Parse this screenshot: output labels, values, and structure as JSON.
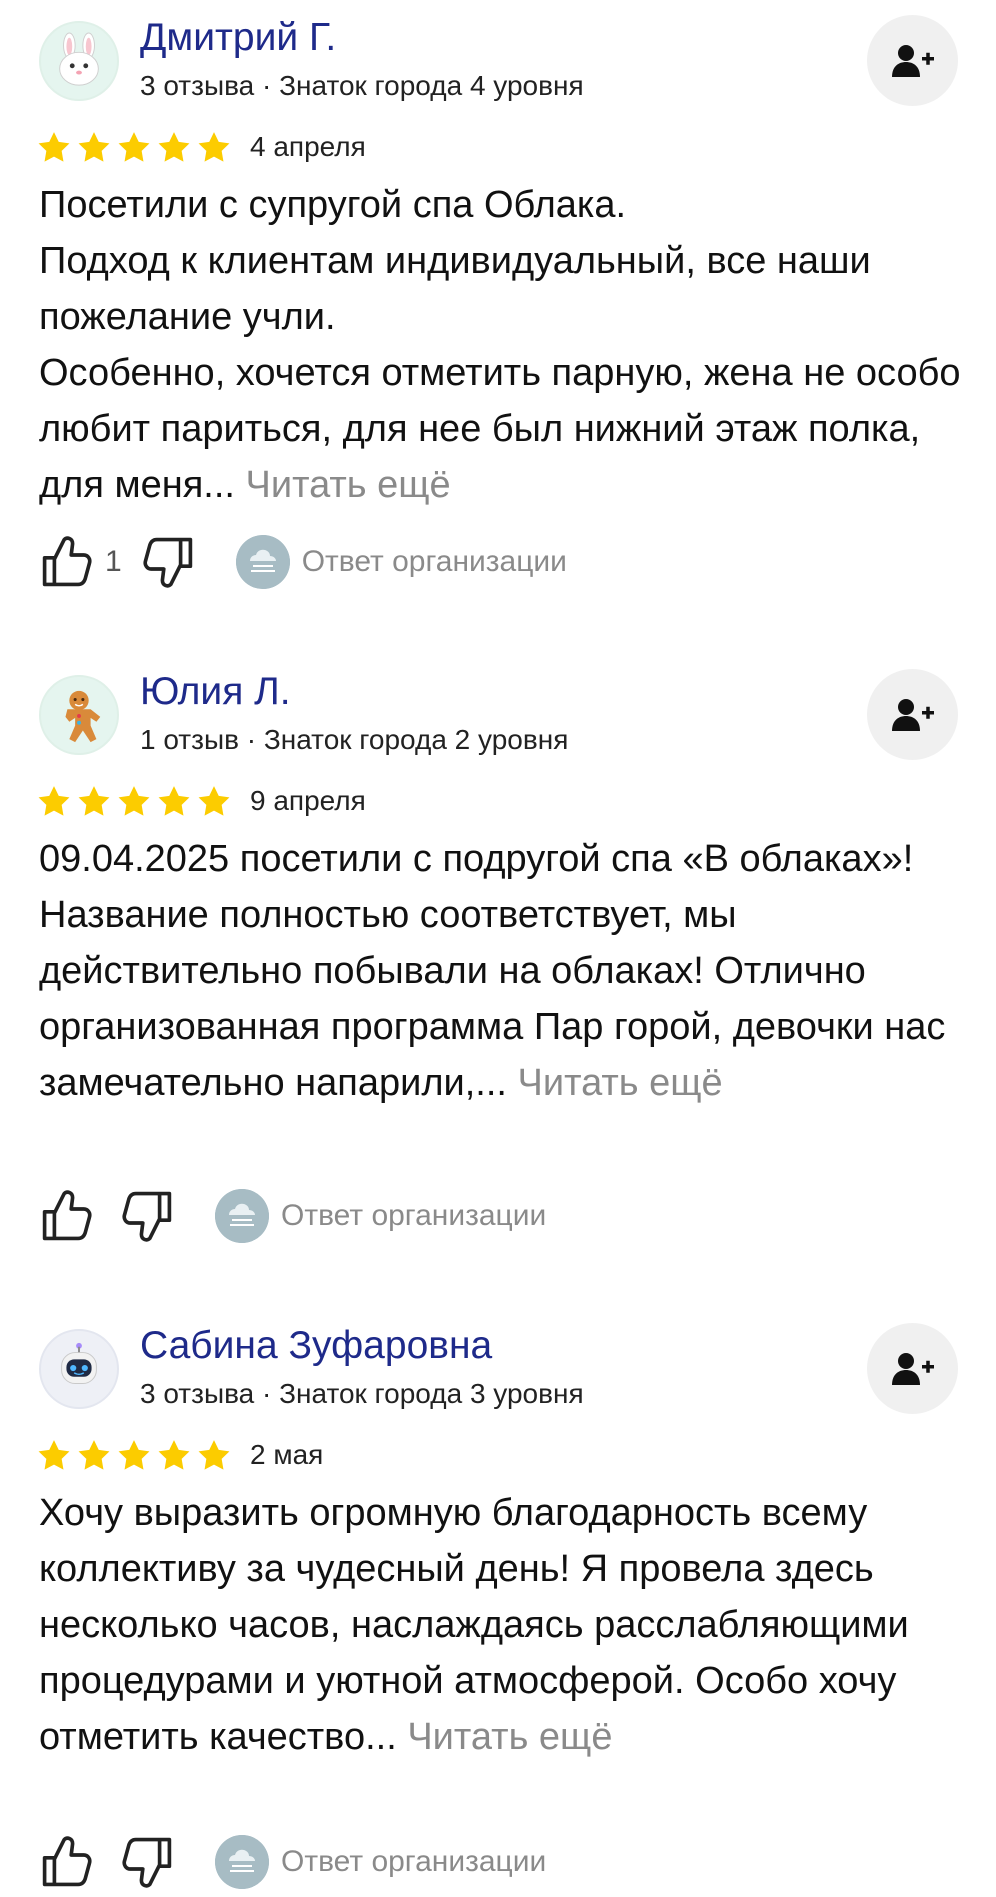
{
  "reviews": [
    {
      "author": "Дмитрий Г.",
      "meta": "3 отзыва · Знаток города 4 уровня",
      "avatar_icon": "bunny-icon",
      "rating": 5,
      "date": "4 апреля",
      "lines": [
        "Посетили с супругой спа Облака.",
        "Подход к клиентам индивидуальный, все наши пожелание учли.",
        "Особенно, хочется отметить парную, жена не особо любит париться, для нее был нижний этаж полка, для меня..."
      ],
      "read_more": "Читать ещё",
      "likes": "1",
      "org_reply": "Ответ организации"
    },
    {
      "author": "Юлия Л.",
      "meta": "1 отзыв · Знаток города 2 уровня",
      "avatar_icon": "gingerbread-icon",
      "rating": 5,
      "date": "9 апреля",
      "lines": [
        "09.04.2025 посетили с подругой спа «В облаках»! Название полностью соответствует, мы действительно побывали на облаках! Отлично организованная программа Пар горой, девочки нас замечательно напарили,..."
      ],
      "read_more": "Читать ещё",
      "likes": "",
      "org_reply": "Ответ организации"
    },
    {
      "author": "Сабина Зуфаровна",
      "meta": "3 отзыва · Знаток города 3 уровня",
      "avatar_icon": "robot-icon",
      "rating": 5,
      "date": "2 мая",
      "lines": [
        "Хочу выразить огромную благодарность всему коллективу за чудесный день! Я провела здесь несколько часов, наслаждаясь расслабляющими процедурами и уютной атмосферой. Особо хочу отметить качество..."
      ],
      "read_more": "Читать ещё",
      "likes": "",
      "org_reply": "Ответ организации"
    }
  ],
  "colors": {
    "author": "#1e2a8a",
    "star": "#fccc00",
    "muted": "#8a8a8a"
  }
}
